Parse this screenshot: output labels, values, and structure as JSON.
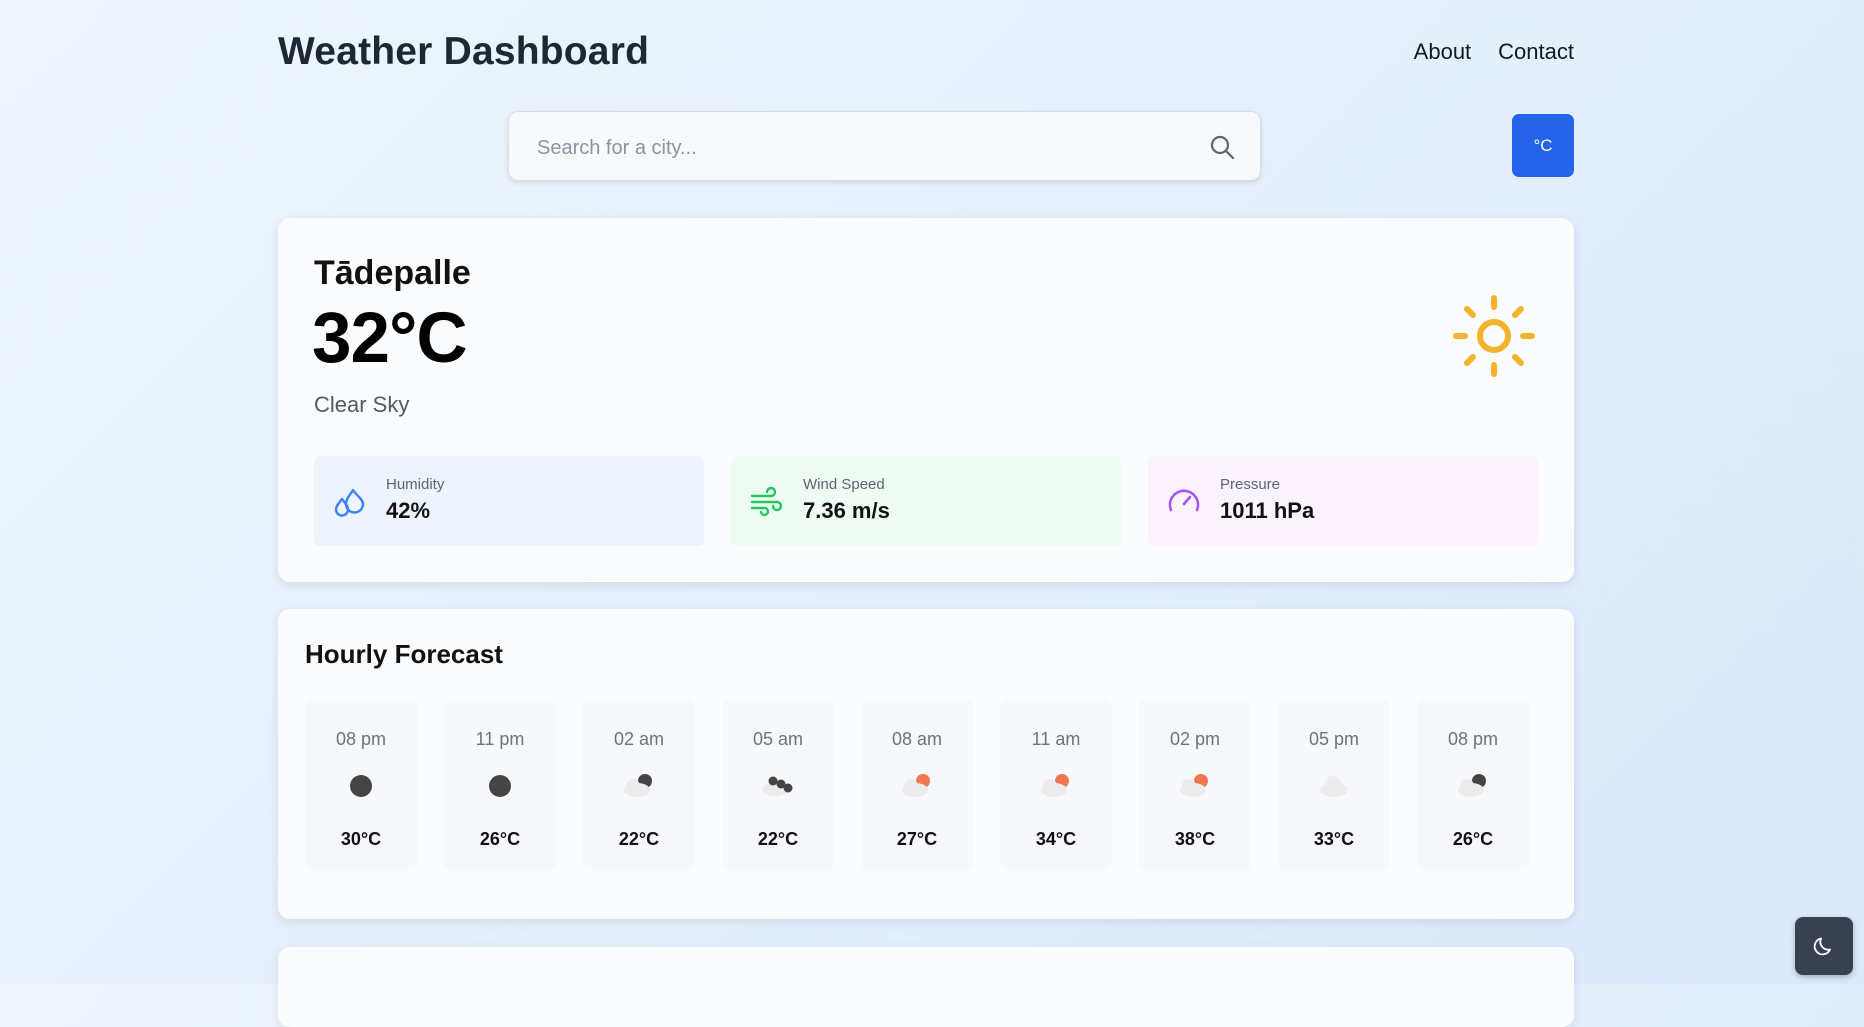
{
  "header": {
    "title": "Weather Dashboard",
    "nav": [
      {
        "label": "About"
      },
      {
        "label": "Contact"
      }
    ]
  },
  "search": {
    "placeholder": "Search for a city...",
    "value": ""
  },
  "unit_toggle": {
    "label": "°C"
  },
  "current": {
    "city": "Tādepalle",
    "temperature": "32°C",
    "condition": "Clear Sky",
    "icon": "sun-icon",
    "stats": {
      "humidity": {
        "label": "Humidity",
        "value": "42%",
        "icon": "humidity-icon",
        "color": "#3b82f6"
      },
      "wind": {
        "label": "Wind Speed",
        "value": "7.36 m/s",
        "icon": "wind-icon",
        "color": "#22c55e"
      },
      "pressure": {
        "label": "Pressure",
        "value": "1011 hPa",
        "icon": "gauge-icon",
        "color": "#a855f7"
      }
    }
  },
  "hourly": {
    "title": "Hourly Forecast",
    "items": [
      {
        "time": "08 pm",
        "temp": "30°C",
        "icon": "moon-icon"
      },
      {
        "time": "11 pm",
        "temp": "26°C",
        "icon": "moon-icon"
      },
      {
        "time": "02 am",
        "temp": "22°C",
        "icon": "cloudy-night-icon"
      },
      {
        "time": "05 am",
        "temp": "22°C",
        "icon": "broken-clouds-night-icon"
      },
      {
        "time": "08 am",
        "temp": "27°C",
        "icon": "cloudy-day-icon"
      },
      {
        "time": "11 am",
        "temp": "34°C",
        "icon": "cloudy-day-icon"
      },
      {
        "time": "02 pm",
        "temp": "38°C",
        "icon": "cloudy-day-icon"
      },
      {
        "time": "05 pm",
        "temp": "33°C",
        "icon": "cloud-icon"
      },
      {
        "time": "08 pm",
        "temp": "26°C",
        "icon": "cloudy-night-icon"
      }
    ]
  },
  "colors": {
    "accent": "#2563eb",
    "sun": "#f6b22c",
    "day_sun": "#f07651",
    "moon": "#444444"
  },
  "theme_toggle": {
    "icon": "moon-icon"
  }
}
